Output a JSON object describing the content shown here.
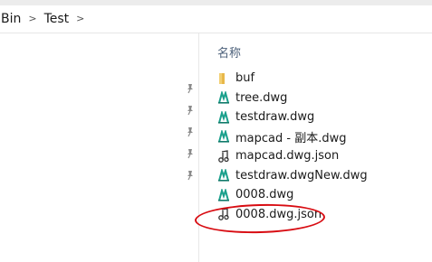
{
  "breadcrumb": {
    "items": [
      "Bin",
      "Test"
    ],
    "separator": ">"
  },
  "file_list": {
    "column_header": "名称",
    "rows": [
      {
        "label": "buf",
        "icon": "folder-icon"
      },
      {
        "label": "tree.dwg",
        "icon": "dwg-file-icon"
      },
      {
        "label": "testdraw.dwg",
        "icon": "dwg-file-icon"
      },
      {
        "label": "mapcad - 副本.dwg",
        "icon": "dwg-file-icon"
      },
      {
        "label": "mapcad.dwg.json",
        "icon": "json-file-icon"
      },
      {
        "label": "testdraw.dwgNew.dwg",
        "icon": "dwg-file-icon"
      },
      {
        "label": "0008.dwg",
        "icon": "dwg-file-icon"
      },
      {
        "label": "0008.dwg.json",
        "icon": "json-file-icon"
      }
    ]
  },
  "quick_access_pins": [
    "pin-icon",
    "pin-icon",
    "pin-icon",
    "pin-icon",
    "pin-icon"
  ],
  "colors": {
    "annotation_circle": "#d80c12",
    "dwg_icon": "#1aa08c",
    "folder_icon": "#e8b84a",
    "header_text": "#4c607a"
  }
}
